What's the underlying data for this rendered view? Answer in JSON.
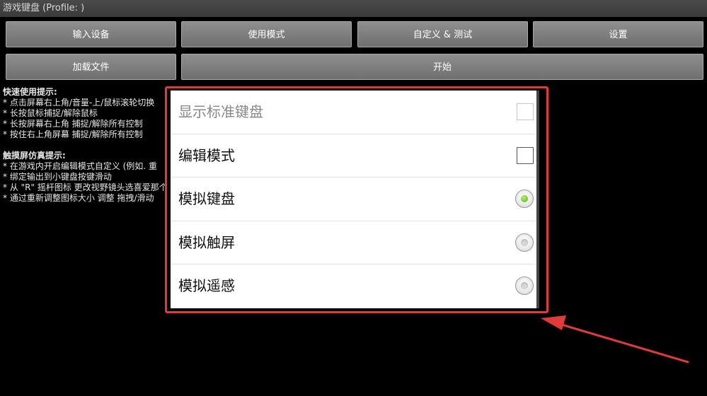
{
  "window": {
    "title": "游戏键盘 (Profile: )"
  },
  "toolbar": {
    "input_device": "输入设备",
    "usage_mode": "使用模式",
    "customize_test": "自定义 & 测试",
    "settings": "设置",
    "load_file": "加载文件",
    "start": "开始"
  },
  "tips": {
    "quick_title": "快速使用提示:",
    "quick_lines": [
      "* 点击屏幕右上角/音量-上/鼠标滚轮切换",
      "* 长按鼠标捕捉/解除鼠标",
      "* 长按屏幕右上角 捕捉/解除所有控制",
      "* 按住右上角屏幕 捕捉/解除所有控制"
    ],
    "touch_title": "触摸屏仿真提示:",
    "touch_lines": [
      "* 在游戏内开启编辑模式自定义 (例如. 重",
      "* 绑定输出到小键盘按键滑动",
      "* 从 \"R\" 摇杆图标 更改视野镜头选喜爱那个",
      "* 通过重新调整图标大小 调整 拖拽/滑动"
    ]
  },
  "dialog": {
    "items": [
      {
        "label": "显示标准键盘",
        "control": "checkbox",
        "checked": false,
        "enabled": false
      },
      {
        "label": "编辑模式",
        "control": "checkbox",
        "checked": false,
        "enabled": true
      },
      {
        "label": "模拟键盘",
        "control": "radio",
        "checked": true,
        "enabled": true
      },
      {
        "label": "模拟触屏",
        "control": "radio",
        "checked": false,
        "enabled": true
      },
      {
        "label": "模拟遥感",
        "control": "radio",
        "checked": false,
        "enabled": true
      }
    ]
  },
  "colors": {
    "highlight": "#e03a3a",
    "radio_on": "#6cc42a"
  },
  "icons": {
    "radio_on": "radio-selected-icon",
    "radio_off": "radio-unselected-icon",
    "arrow": "pointer-arrow-icon"
  }
}
